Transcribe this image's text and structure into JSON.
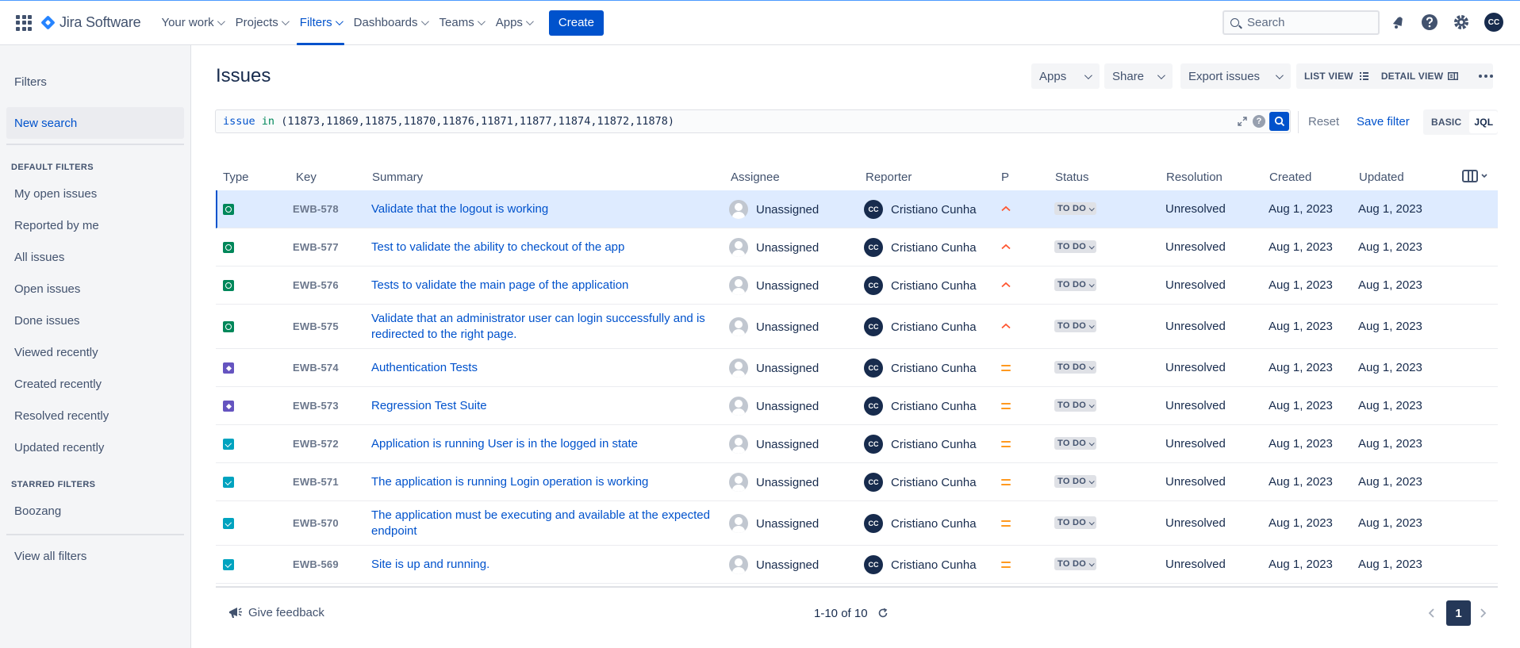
{
  "topnav": {
    "logo": "Jira Software",
    "items": [
      {
        "label": "Your work"
      },
      {
        "label": "Projects"
      },
      {
        "label": "Filters"
      },
      {
        "label": "Dashboards"
      },
      {
        "label": "Teams"
      },
      {
        "label": "Apps"
      }
    ],
    "active_item": "Filters",
    "create_label": "Create",
    "search_placeholder": "Search",
    "user_initials": "CC",
    "icons": [
      "app-switcher-icon",
      "notifications-icon",
      "help-icon",
      "settings-icon"
    ]
  },
  "sidebar": {
    "title": "Filters",
    "new_search": "New search",
    "default_heading": "DEFAULT FILTERS",
    "default_filters": [
      "My open issues",
      "Reported by me",
      "All issues",
      "Open issues",
      "Done issues",
      "Viewed recently",
      "Created recently",
      "Resolved recently",
      "Updated recently"
    ],
    "starred_heading": "STARRED FILTERS",
    "starred_filters": [
      "Boozang"
    ],
    "view_all": "View all filters"
  },
  "header": {
    "title": "Issues",
    "apps_label": "Apps",
    "share_label": "Share",
    "export_label": "Export issues",
    "list_view_label": "LIST VIEW",
    "detail_view_label": "DETAIL VIEW"
  },
  "query": {
    "keyword": "issue",
    "operator": "in",
    "values": "(11873,11869,11875,11870,11876,11871,11877,11874,11872,11878)",
    "reset_label": "Reset",
    "save_label": "Save filter",
    "basic_label": "BASIC",
    "jql_label": "JQL",
    "help_glyph": "?"
  },
  "table": {
    "columns": [
      "Type",
      "Key",
      "Summary",
      "Assignee",
      "Reporter",
      "P",
      "Status",
      "Resolution",
      "Created",
      "Updated"
    ],
    "rows": [
      {
        "type": "test",
        "key": "EWB-578",
        "summary": "Validate that the logout is working",
        "assignee": "Unassigned",
        "reporter": "Cristiano Cunha",
        "reporter_initials": "CC",
        "priority": "high",
        "status": "TO DO",
        "resolution": "Unresolved",
        "created": "Aug 1, 2023",
        "updated": "Aug 1, 2023",
        "selected": true
      },
      {
        "type": "test",
        "key": "EWB-577",
        "summary": "Test to validate the ability to checkout of the app",
        "assignee": "Unassigned",
        "reporter": "Cristiano Cunha",
        "reporter_initials": "CC",
        "priority": "high",
        "status": "TO DO",
        "resolution": "Unresolved",
        "created": "Aug 1, 2023",
        "updated": "Aug 1, 2023"
      },
      {
        "type": "test",
        "key": "EWB-576",
        "summary": "Tests to validate the main page of the application",
        "assignee": "Unassigned",
        "reporter": "Cristiano Cunha",
        "reporter_initials": "CC",
        "priority": "high",
        "status": "TO DO",
        "resolution": "Unresolved",
        "created": "Aug 1, 2023",
        "updated": "Aug 1, 2023"
      },
      {
        "type": "test",
        "key": "EWB-575",
        "summary": "Validate that an administrator user can login successfully and is redirected to the right page.",
        "assignee": "Unassigned",
        "reporter": "Cristiano Cunha",
        "reporter_initials": "CC",
        "priority": "high",
        "status": "TO DO",
        "resolution": "Unresolved",
        "created": "Aug 1, 2023",
        "updated": "Aug 1, 2023"
      },
      {
        "type": "suite",
        "key": "EWB-574",
        "summary": "Authentication Tests",
        "assignee": "Unassigned",
        "reporter": "Cristiano Cunha",
        "reporter_initials": "CC",
        "priority": "medium",
        "status": "TO DO",
        "resolution": "Unresolved",
        "created": "Aug 1, 2023",
        "updated": "Aug 1, 2023"
      },
      {
        "type": "suite",
        "key": "EWB-573",
        "summary": "Regression Test Suite",
        "assignee": "Unassigned",
        "reporter": "Cristiano Cunha",
        "reporter_initials": "CC",
        "priority": "medium",
        "status": "TO DO",
        "resolution": "Unresolved",
        "created": "Aug 1, 2023",
        "updated": "Aug 1, 2023"
      },
      {
        "type": "precondition",
        "key": "EWB-572",
        "summary": "Application is running User is in the logged in state",
        "assignee": "Unassigned",
        "reporter": "Cristiano Cunha",
        "reporter_initials": "CC",
        "priority": "medium",
        "status": "TO DO",
        "resolution": "Unresolved",
        "created": "Aug 1, 2023",
        "updated": "Aug 1, 2023"
      },
      {
        "type": "precondition",
        "key": "EWB-571",
        "summary": "The application is running Login operation is working",
        "assignee": "Unassigned",
        "reporter": "Cristiano Cunha",
        "reporter_initials": "CC",
        "priority": "medium",
        "status": "TO DO",
        "resolution": "Unresolved",
        "created": "Aug 1, 2023",
        "updated": "Aug 1, 2023"
      },
      {
        "type": "precondition",
        "key": "EWB-570",
        "summary": "The application must be executing and available at the expected endpoint",
        "assignee": "Unassigned",
        "reporter": "Cristiano Cunha",
        "reporter_initials": "CC",
        "priority": "medium",
        "status": "TO DO",
        "resolution": "Unresolved",
        "created": "Aug 1, 2023",
        "updated": "Aug 1, 2023"
      },
      {
        "type": "precondition",
        "key": "EWB-569",
        "summary": "Site is up and running.",
        "assignee": "Unassigned",
        "reporter": "Cristiano Cunha",
        "reporter_initials": "CC",
        "priority": "medium",
        "status": "TO DO",
        "resolution": "Unresolved",
        "created": "Aug 1, 2023",
        "updated": "Aug 1, 2023"
      }
    ]
  },
  "footer": {
    "feedback_label": "Give feedback",
    "count_label": "1-10 of 10",
    "current_page": "1"
  },
  "colors": {
    "brand": "#0052cc",
    "selected_row": "#deebff",
    "priority_high": "#ff5630",
    "priority_medium": "#ff991f",
    "type_test": "#00875a",
    "type_suite": "#6554c0",
    "type_precondition": "#00a3bf"
  }
}
